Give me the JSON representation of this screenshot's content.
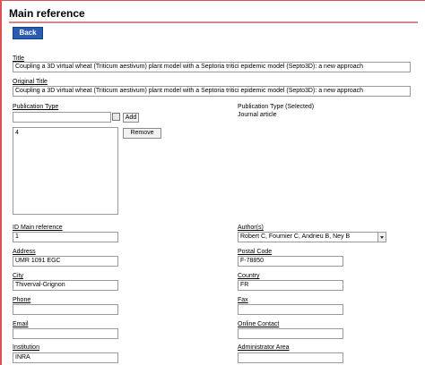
{
  "header": {
    "title": "Main reference",
    "back_label": "Back"
  },
  "title_field": {
    "label": "Title",
    "value": "Coupling a 3D virtual wheat (Triticum aestivum) plant model with a Septoria tritici epidemic model (Septo3D): a new approach"
  },
  "original_title_field": {
    "label": "Original Title",
    "value": "Coupling a 3D virtual wheat (Triticum aestivum) plant model with a Septoria tritici epidemic model (Septo3D): a new approach"
  },
  "publication_type": {
    "label": "Publication Type",
    "input_value": "",
    "add_label": "Add",
    "remove_label": "Remove",
    "list_items": [
      "4"
    ],
    "selected_label": "Publication Type (Selected)",
    "selected_value": "Journal article"
  },
  "fields": {
    "id_main_reference": {
      "label": "ID Main reference",
      "value": "1"
    },
    "authors": {
      "label": "Author(s)",
      "value": "Robert C, Fournier C, Andrieu B, Ney B"
    },
    "address": {
      "label": "Address",
      "value": "UMR 1091 EGC"
    },
    "postal_code": {
      "label": "Postal Code",
      "value": "F-78850"
    },
    "city": {
      "label": "City",
      "value": "Thiverval-Grignon"
    },
    "country": {
      "label": "Country",
      "value": "FR"
    },
    "phone": {
      "label": "Phone",
      "value": ""
    },
    "fax": {
      "label": "Fax",
      "value": ""
    },
    "email": {
      "label": "Email",
      "value": ""
    },
    "online_contact": {
      "label": "Online Contact",
      "value": ""
    },
    "institution": {
      "label": "Institution",
      "value": "INRA"
    },
    "administrator_area": {
      "label": "Administrator Area",
      "value": ""
    }
  }
}
